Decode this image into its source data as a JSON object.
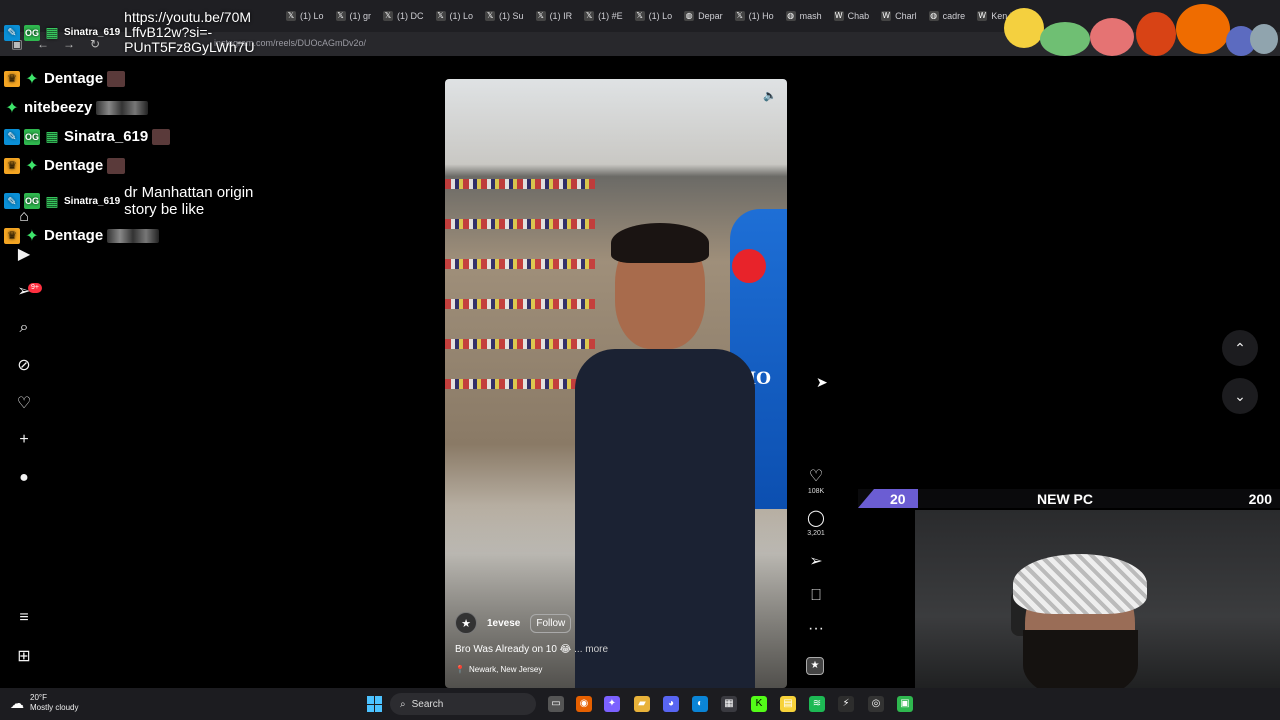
{
  "browser": {
    "url": "instagram.com/reels/DUOcAGmDv2o/",
    "tabs": [
      {
        "icon": "x-icon",
        "label": "(1) Lo"
      },
      {
        "icon": "x-icon",
        "label": "(1) gr"
      },
      {
        "icon": "x-icon",
        "label": "(1) DC"
      },
      {
        "icon": "x-icon",
        "label": "(1) Lo"
      },
      {
        "icon": "x-icon",
        "label": "(1) Su"
      },
      {
        "icon": "x-icon",
        "label": "(1) IR"
      },
      {
        "icon": "x-icon",
        "label": "(1) #E"
      },
      {
        "icon": "x-icon",
        "label": "(1) Lo"
      },
      {
        "icon": "globe-icon",
        "label": "Depar"
      },
      {
        "icon": "x-icon",
        "label": "(1) Ho"
      },
      {
        "icon": "globe-icon",
        "label": "mash"
      },
      {
        "icon": "wiki-icon",
        "label": "Chab"
      },
      {
        "icon": "wiki-icon",
        "label": "Charl"
      },
      {
        "icon": "globe-icon",
        "label": "cadre"
      },
      {
        "icon": "wiki-icon",
        "label": "Ken K"
      }
    ]
  },
  "chat": {
    "link_message": "https://youtu.be/70M LffvB12w?si=-PUnT5Fz8GyLWh7U",
    "link_user": "Sinatra_619",
    "rows": [
      {
        "user": "Dentage",
        "message": "",
        "badges": [
          "crown",
          "star"
        ],
        "emote": "single"
      },
      {
        "user": "nitebeezy",
        "message": "",
        "badges": [
          "star"
        ],
        "emote": "wide"
      },
      {
        "user": "Sinatra_619",
        "message": "",
        "badges": [
          "pencil",
          "og",
          "gift"
        ],
        "emote": "single"
      },
      {
        "user": "Dentage",
        "message": "",
        "badges": [
          "crown",
          "star"
        ],
        "emote": "single"
      },
      {
        "user": "Sinatra_619",
        "message": "dr Manhattan origin story be like",
        "badges": [
          "pencil",
          "og",
          "gift"
        ],
        "emote": "none"
      },
      {
        "user": "Dentage",
        "message": "",
        "badges": [
          "crown",
          "star"
        ],
        "emote": "wide"
      }
    ]
  },
  "instagram": {
    "notifications_badge": "9+",
    "reel": {
      "username": "1evese",
      "follow_label": "Follow",
      "caption": "Bro Was Already on 10 😂",
      "more_label": "... more",
      "location": "Newark, New Jersey",
      "sign_text": "BMO",
      "likes": "108K",
      "comments": "3,201"
    }
  },
  "goal": {
    "current": "20",
    "title": "NEW PC",
    "target": "200",
    "progress": 0.1,
    "color": "#6b5dd3"
  },
  "taskbar": {
    "temperature": "20°F",
    "condition": "Mostly cloudy",
    "search_label": "Search"
  }
}
